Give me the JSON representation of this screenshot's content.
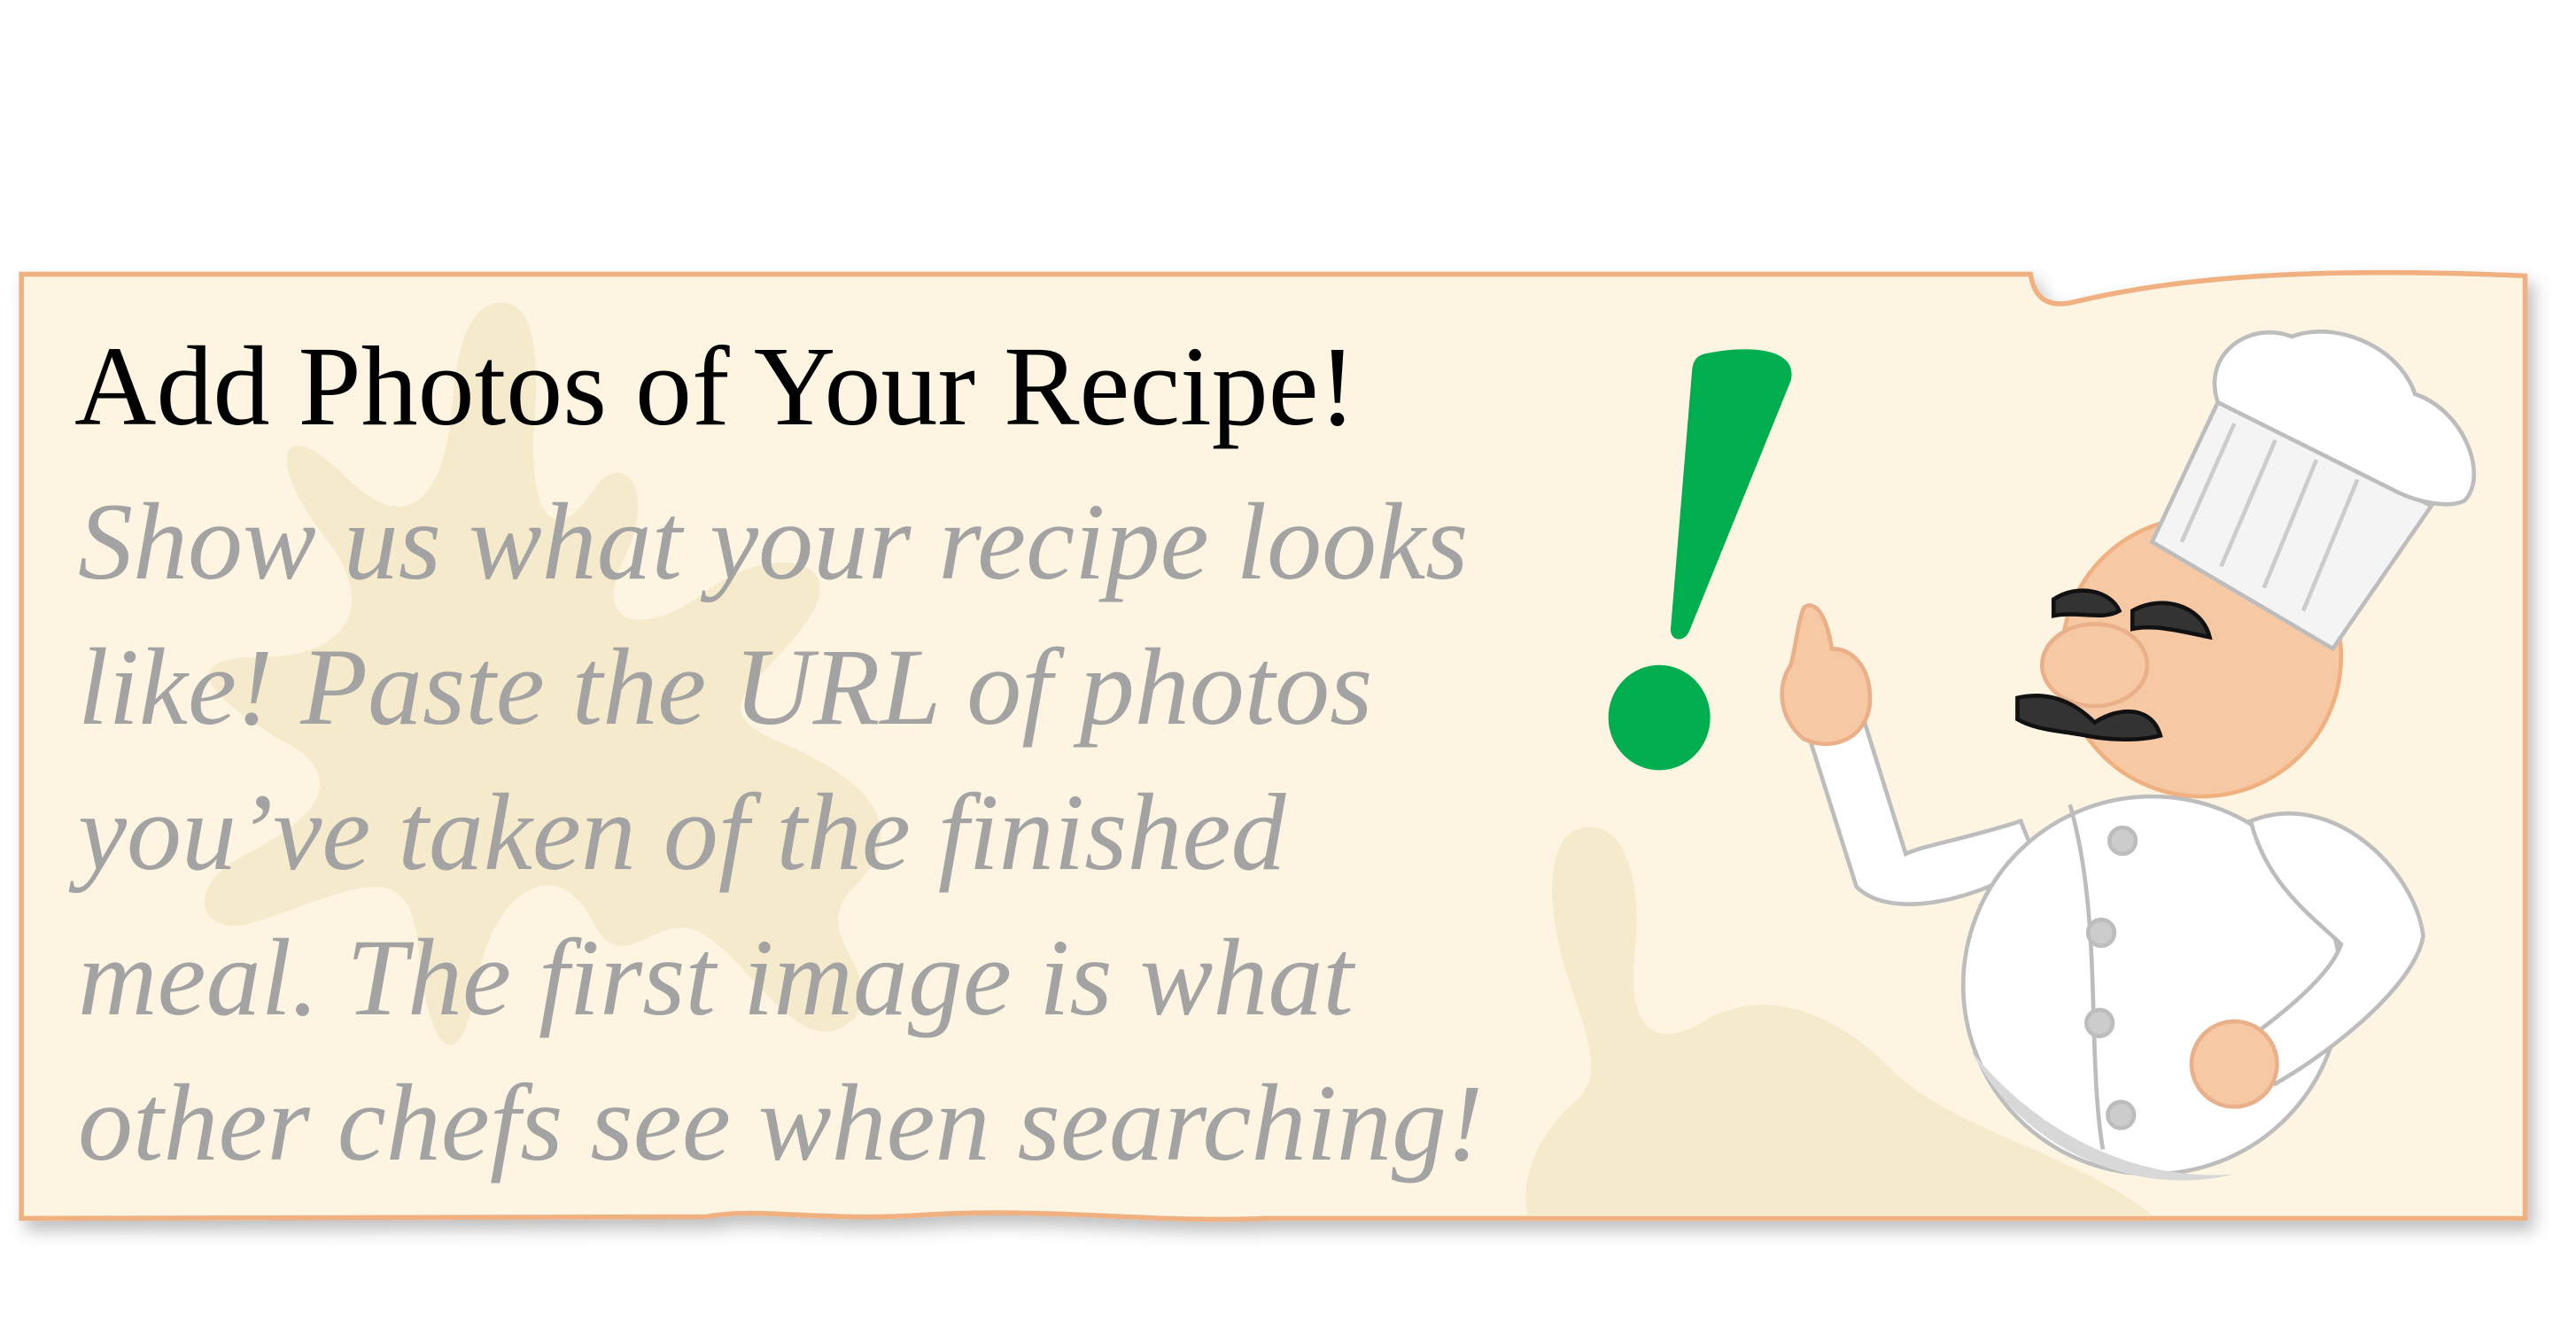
{
  "banner": {
    "title": "Add Photos of Your Recipe!",
    "message_lines": [
      "Show us what your recipe looks",
      "like! Paste the URL of photos",
      "you’ve taken of the finished",
      "meal. The first image is what",
      "other chefs see when searching!"
    ],
    "illustration": "chef-pointing-icon",
    "emphasis": "exclamation-icon"
  },
  "colors": {
    "card_fill": "#fdf5e2",
    "card_border": "#f0b080",
    "splat": "#f5eacb",
    "message_text": "#a3a3a3",
    "exclamation": "#00ad4f",
    "skin": "#f6c8a4"
  }
}
